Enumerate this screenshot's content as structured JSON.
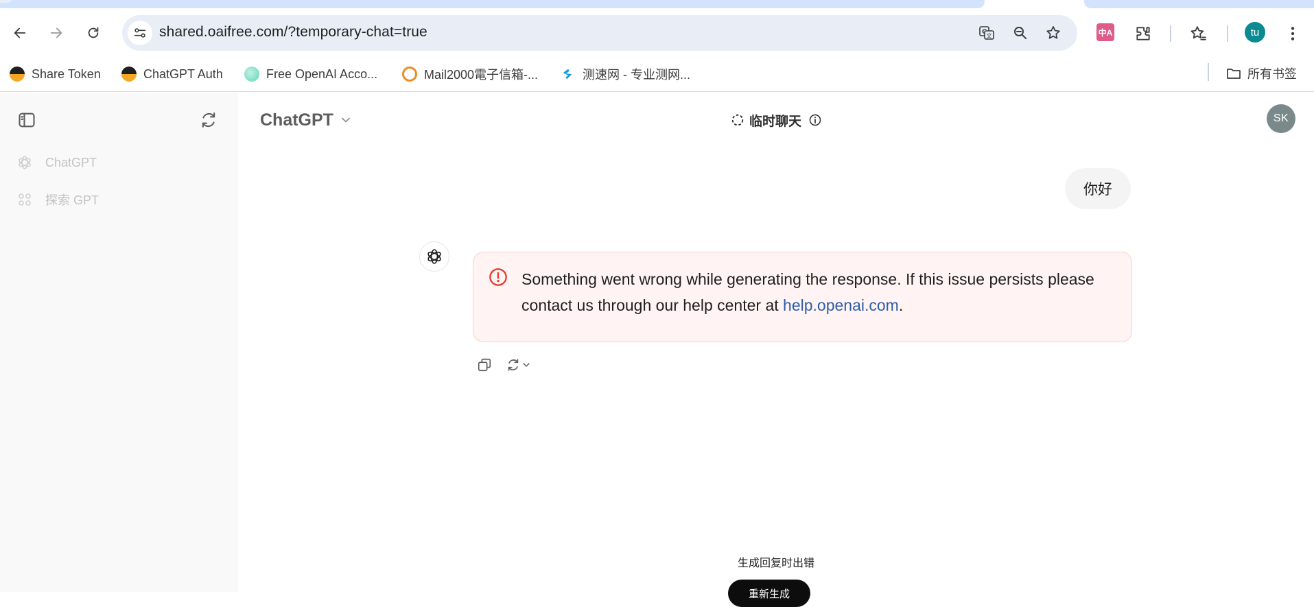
{
  "browser": {
    "url": "shared.oaifree.com/?temporary-chat=true",
    "profile_initials": "tu",
    "ext_badge": "中A",
    "bookmarks": [
      {
        "label": "Share Token",
        "icon": "token-favicon"
      },
      {
        "label": "ChatGPT Auth",
        "icon": "token-favicon"
      },
      {
        "label": "Free OpenAI Acco...",
        "icon": "mint-favicon"
      },
      {
        "label": "Mail2000電子信箱-...",
        "icon": "mail-favicon"
      },
      {
        "label": "测速网 - 专业测网...",
        "icon": "speedtest-favicon"
      }
    ],
    "all_bookmarks_label": "所有书签"
  },
  "sidebar": {
    "items": [
      {
        "label": "ChatGPT",
        "icon": "openai-icon"
      },
      {
        "label": "探索 GPT",
        "icon": "grid-icon"
      }
    ]
  },
  "header": {
    "model_name": "ChatGPT",
    "temporary_chat_label": "临时聊天",
    "avatar_initials": "SK"
  },
  "conversation": {
    "user_message": "你好",
    "error_message": "Something went wrong while generating the response. If this issue persists please contact us through our help center at ",
    "error_link": "help.openai.com",
    "error_suffix": "."
  },
  "footer": {
    "error_text": "生成回复时出错",
    "regenerate_label": "重新生成"
  },
  "colors": {
    "accent_link": "#2f5ea8",
    "error_bg": "#fff4f3",
    "error_border": "#fbd0cc",
    "error_icon": "#e0402f"
  }
}
